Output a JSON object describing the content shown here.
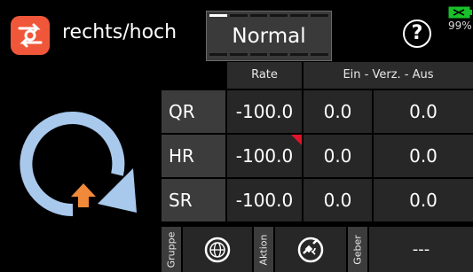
{
  "header": {
    "title": "rechts/hoch",
    "mode": "Normal",
    "help_label": "?",
    "battery_percent": "99%"
  },
  "table": {
    "columns": [
      "Rate",
      "Ein - Verz. - Aus"
    ],
    "rows": [
      {
        "label": "QR",
        "rate": "-100.0",
        "ein": "0.0",
        "aus": "0.0"
      },
      {
        "label": "HR",
        "rate": "-100.0",
        "ein": "0.0",
        "aus": "0.0"
      },
      {
        "label": "SR",
        "rate": "-100.0",
        "ein": "0.0",
        "aus": "0.0"
      }
    ]
  },
  "bottom": {
    "group_label": "Gruppe",
    "action_label": "Aktion",
    "encoder_label": "Geber",
    "encoder_value": "---"
  },
  "colors": {
    "accent": "#f0573a",
    "arrow_blue": "#a9c9ec",
    "arrow_orange": "#f08a3a",
    "marker_red": "#e0142a",
    "battery_green": "#19c02a"
  },
  "icons": {
    "app": "servo-swap-icon",
    "group": "globe-icon",
    "action": "satellite-icon",
    "rotation": "clockwise-rotation-icon"
  }
}
